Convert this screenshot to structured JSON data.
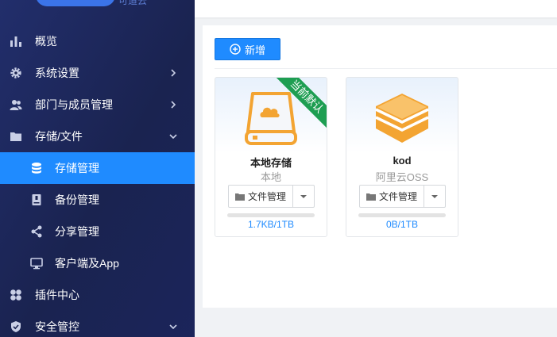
{
  "sidebar": {
    "logo_sub": "可道云",
    "items": [
      {
        "label": "概览",
        "icon": "bar-chart-icon",
        "has_arrow": false
      },
      {
        "label": "系统设置",
        "icon": "gear-icon",
        "has_arrow": true
      },
      {
        "label": "部门与成员管理",
        "icon": "users-icon",
        "has_arrow": true
      },
      {
        "label": "存储/文件",
        "icon": "folder-icon",
        "has_arrow": true,
        "expanded": true
      },
      {
        "label": "存储管理",
        "icon": "database-icon",
        "sub": true,
        "active": true
      },
      {
        "label": "备份管理",
        "icon": "backup-drive-icon",
        "sub": true
      },
      {
        "label": "分享管理",
        "icon": "share-icon",
        "sub": true
      },
      {
        "label": "客户端及App",
        "icon": "monitor-icon",
        "sub": true
      },
      {
        "label": "插件中心",
        "icon": "plugin-icon",
        "has_arrow": false
      },
      {
        "label": "安全管控",
        "icon": "shield-icon",
        "has_arrow": true,
        "expanded": true
      }
    ]
  },
  "toolbar": {
    "add_label": "新增"
  },
  "cards": [
    {
      "name": "本地存储",
      "type": "本地",
      "ribbon": "当前默认",
      "action_label": "文件管理",
      "usage": "1.7KB/1TB",
      "usage_fraction": 0.0,
      "icon": "local-drive-icon"
    },
    {
      "name": "kod",
      "type": "阿里云OSS",
      "ribbon": "",
      "action_label": "文件管理",
      "usage": "0B/1TB",
      "usage_fraction": 0.0,
      "icon": "kod-box-icon"
    }
  ],
  "colors": {
    "sidebar_bg": "#1a2350",
    "accent": "#1f8bff",
    "ribbon": "#1e9e52",
    "icon_orange": "#f3a432"
  }
}
